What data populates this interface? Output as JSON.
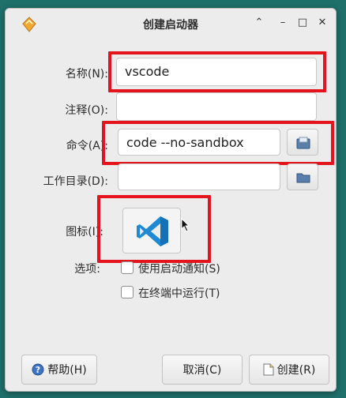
{
  "window": {
    "title": "创建启动器"
  },
  "icons": {
    "app": "launcher-app-icon",
    "window_up": "chevron-up-icon",
    "window_min": "minimize-icon",
    "window_max": "maximize-icon",
    "window_close": "close-icon",
    "browse_command": "open-file-icon",
    "browse_dir": "folder-icon",
    "launcher_icon": "vscode-icon",
    "help": "help-icon",
    "create": "new-document-icon"
  },
  "form": {
    "name_label": "名称(N):",
    "name_value": "vscode",
    "comment_label": "注释(O):",
    "comment_value": "",
    "command_label": "命令(A):",
    "command_value": "code --no-sandbox",
    "workdir_label": "工作目录(D):",
    "workdir_value": "",
    "icon_label": "图标(I):",
    "options_label": "选项:",
    "option_notify": "使用启动通知(S)",
    "option_notify_checked": false,
    "option_terminal": "在终端中运行(T)",
    "option_terminal_checked": false
  },
  "buttons": {
    "help": "帮助(H)",
    "cancel": "取消(C)",
    "create": "创建(R)"
  },
  "colors": {
    "highlight": "#e3141b",
    "background": "#1f6f6a",
    "vscode_blue": "#1f8ad2"
  }
}
